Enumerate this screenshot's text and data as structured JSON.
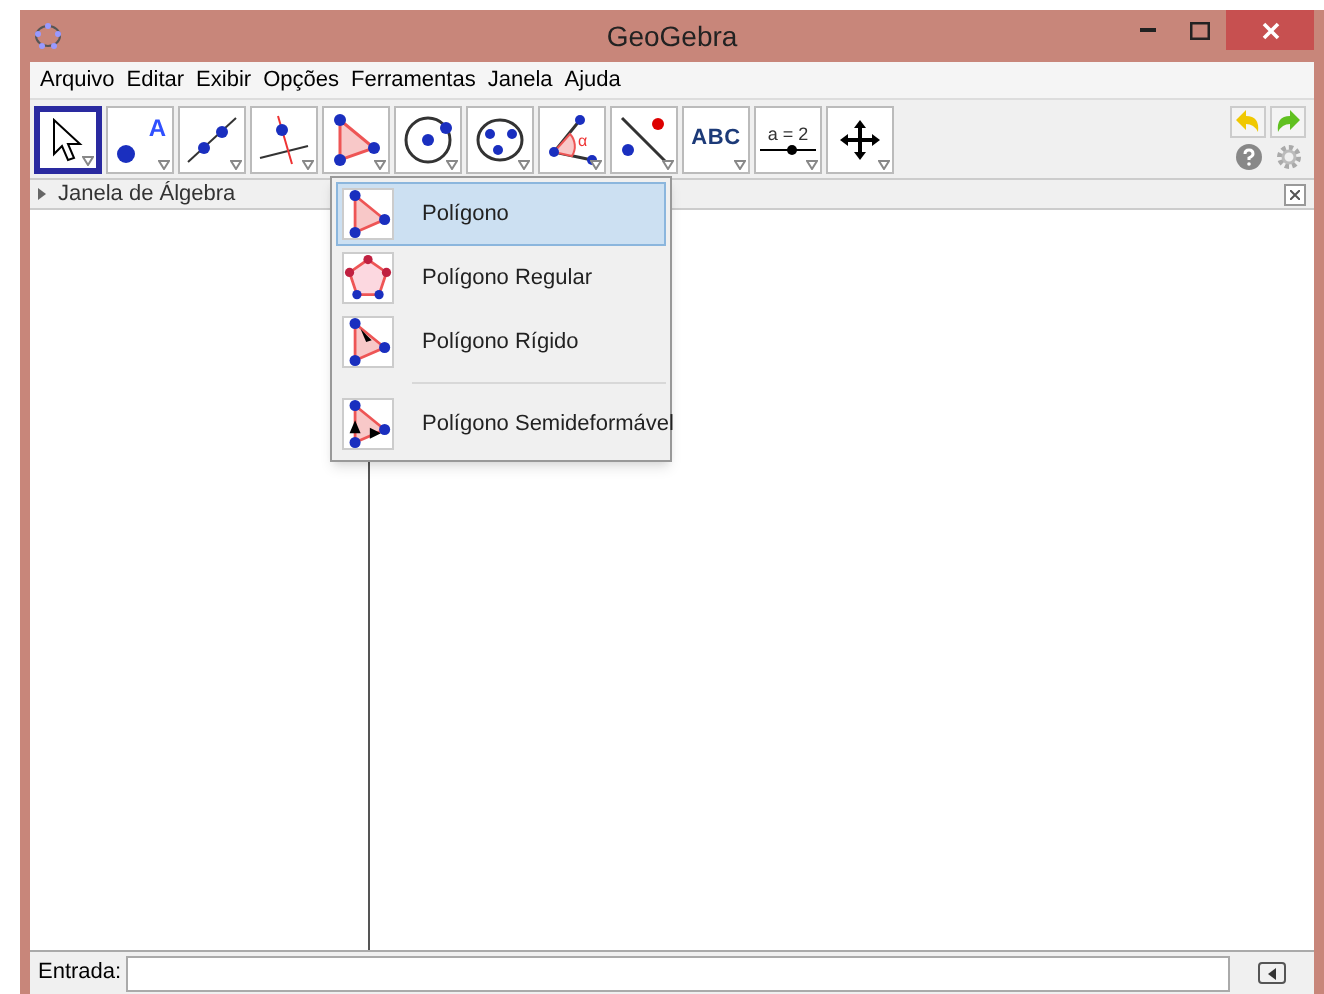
{
  "window": {
    "title": "GeoGebra"
  },
  "menu": [
    "Arquivo",
    "Editar",
    "Exibir",
    "Opções",
    "Ferramentas",
    "Janela",
    "Ajuda"
  ],
  "tools": [
    {
      "kind": "pointer",
      "selected": true
    },
    {
      "kind": "point",
      "selected": false,
      "label": "A"
    },
    {
      "kind": "line",
      "selected": false
    },
    {
      "kind": "perpendicular",
      "selected": false
    },
    {
      "kind": "polygon",
      "selected": false
    },
    {
      "kind": "circle",
      "selected": false
    },
    {
      "kind": "conic",
      "selected": false
    },
    {
      "kind": "angle",
      "selected": false,
      "label": "α"
    },
    {
      "kind": "reflect",
      "selected": false
    },
    {
      "kind": "text",
      "selected": false,
      "label": "ABC"
    },
    {
      "kind": "slider",
      "selected": false,
      "label": "a = 2"
    },
    {
      "kind": "move",
      "selected": false
    }
  ],
  "algebra_panel": {
    "title": "Janela de Álgebra"
  },
  "dropdown": [
    {
      "kind": "polygon",
      "label": "Polígono",
      "selected": true,
      "separator_before": false
    },
    {
      "kind": "regular",
      "label": "Polígono Regular",
      "selected": false,
      "separator_before": false
    },
    {
      "kind": "rigid",
      "label": "Polígono Rígido",
      "selected": false,
      "separator_before": false
    },
    {
      "kind": "semi",
      "label": "Polígono Semideformável",
      "selected": false,
      "separator_before": true
    }
  ],
  "input_bar": {
    "label": "Entrada:"
  }
}
